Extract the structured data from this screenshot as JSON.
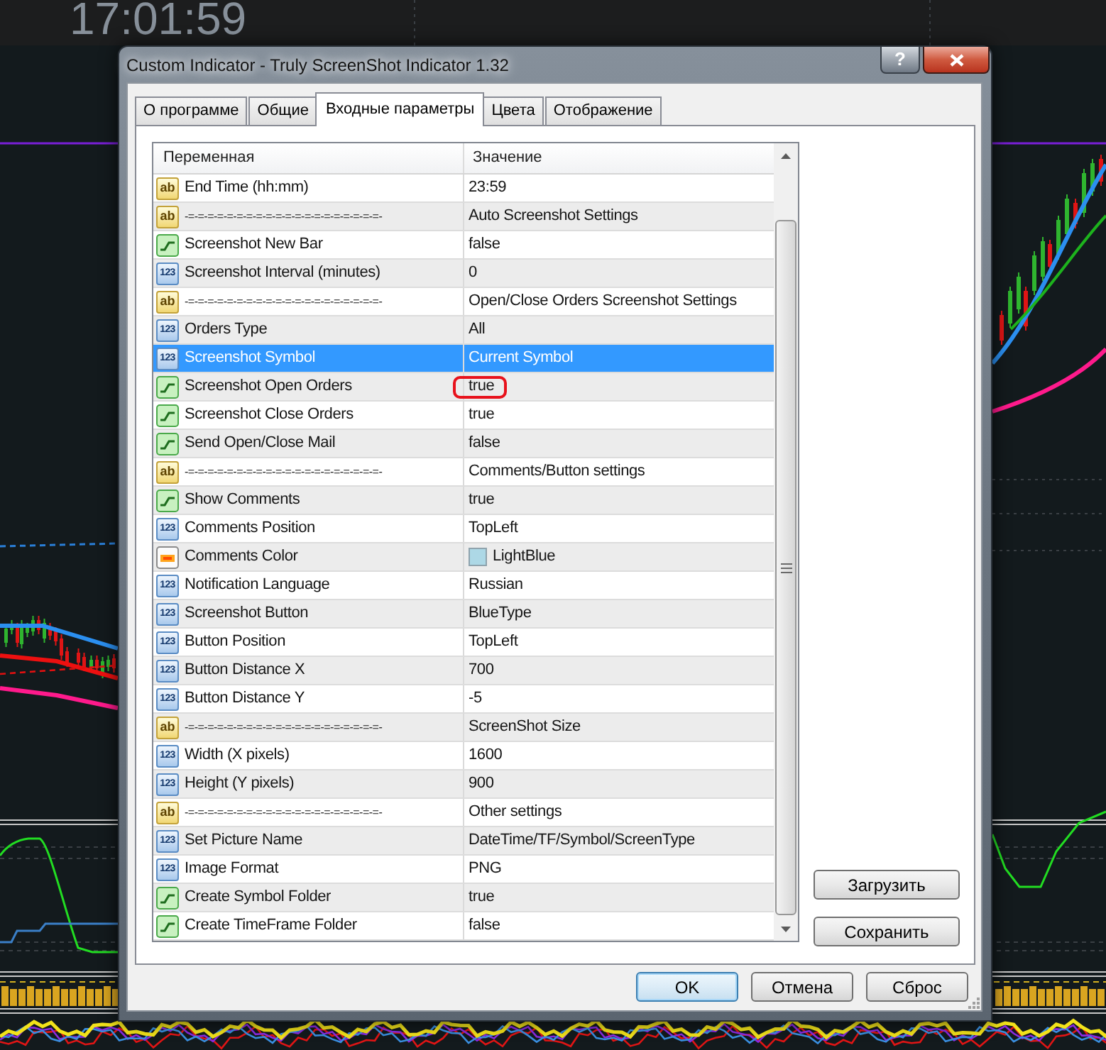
{
  "clock": "17:01:59",
  "window": {
    "title": "Custom Indicator - Truly ScreenShot Indicator 1.32",
    "help_button": "?"
  },
  "tabs": [
    {
      "label": "О программе",
      "selected": false
    },
    {
      "label": "Общие",
      "selected": false
    },
    {
      "label": "Входные параметры",
      "selected": true
    },
    {
      "label": "Цвета",
      "selected": false
    },
    {
      "label": "Отображение",
      "selected": false
    }
  ],
  "table": {
    "columns": [
      "Переменная",
      "Значение"
    ],
    "rows": [
      {
        "kind": "string",
        "type_label": "ab",
        "name": "End Time (hh:mm)",
        "value": "23:59",
        "selected": false,
        "circled": false
      },
      {
        "kind": "separator",
        "type_label": "ab",
        "name": "-=-=-=-=-=-=-=-=-=-=-=-=-=-=-=-=-=-=-=-=-",
        "value": "Auto Screenshot Settings",
        "selected": false,
        "circled": false
      },
      {
        "kind": "bool",
        "name": "Screenshot New Bar",
        "value": "false",
        "selected": false,
        "circled": false
      },
      {
        "kind": "number",
        "type_label": "123",
        "name": "Screenshot Interval (minutes)",
        "value": "0",
        "selected": false,
        "circled": false
      },
      {
        "kind": "separator",
        "type_label": "ab",
        "name": "-=-=-=-=-=-=-=-=-=-=-=-=-=-=-=-=-=-=-=-=-",
        "value": "Open/Close Orders Screenshot Settings",
        "selected": false,
        "circled": false
      },
      {
        "kind": "number",
        "type_label": "123",
        "name": "Orders Type",
        "value": "All",
        "selected": false,
        "circled": false
      },
      {
        "kind": "number",
        "type_label": "123",
        "name": "Screenshot Symbol",
        "value": "Current Symbol",
        "selected": true,
        "circled": false
      },
      {
        "kind": "bool",
        "name": "Screenshot Open Orders",
        "value": "true",
        "selected": false,
        "circled": true
      },
      {
        "kind": "bool",
        "name": "Screenshot Close Orders",
        "value": "true",
        "selected": false,
        "circled": false
      },
      {
        "kind": "bool",
        "name": "Send Open/Close Mail",
        "value": "false",
        "selected": false,
        "circled": false
      },
      {
        "kind": "separator",
        "type_label": "ab",
        "name": "-=-=-=-=-=-=-=-=-=-=-=-=-=-=-=-=-=-=-=-=-",
        "value": "Comments/Button settings",
        "selected": false,
        "circled": false
      },
      {
        "kind": "bool",
        "name": "Show Comments",
        "value": "true",
        "selected": false,
        "circled": false
      },
      {
        "kind": "number",
        "type_label": "123",
        "name": "Comments Position",
        "value": "TopLeft",
        "selected": false,
        "circled": false
      },
      {
        "kind": "color",
        "name": "Comments Color",
        "value": "LightBlue",
        "color": "#add8e6",
        "selected": false,
        "circled": false
      },
      {
        "kind": "number",
        "type_label": "123",
        "name": "Notification Language",
        "value": "Russian",
        "selected": false,
        "circled": false
      },
      {
        "kind": "number",
        "type_label": "123",
        "name": "Screenshot Button",
        "value": "BlueType",
        "selected": false,
        "circled": false
      },
      {
        "kind": "number",
        "type_label": "123",
        "name": "Button Position",
        "value": "TopLeft",
        "selected": false,
        "circled": false
      },
      {
        "kind": "number",
        "type_label": "123",
        "name": "Button Distance X",
        "value": "700",
        "selected": false,
        "circled": false
      },
      {
        "kind": "number",
        "type_label": "123",
        "name": "Button Distance Y",
        "value": "-5",
        "selected": false,
        "circled": false
      },
      {
        "kind": "separator",
        "type_label": "ab",
        "name": "-=-=-=-=-=-=-=-=-=-=-=-=-=-=-=-=-=-=-=-=-",
        "value": "ScreenShot Size",
        "selected": false,
        "circled": false
      },
      {
        "kind": "number",
        "type_label": "123",
        "name": "Width (X pixels)",
        "value": "1600",
        "selected": false,
        "circled": false
      },
      {
        "kind": "number",
        "type_label": "123",
        "name": "Height (Y pixels)",
        "value": "900",
        "selected": false,
        "circled": false
      },
      {
        "kind": "separator",
        "type_label": "ab",
        "name": "-=-=-=-=-=-=-=-=-=-=-=-=-=-=-=-=-=-=-=-=-",
        "value": "Other settings",
        "selected": false,
        "circled": false
      },
      {
        "kind": "number",
        "type_label": "123",
        "name": "Set Picture Name",
        "value": "DateTime/TF/Symbol/ScreenType",
        "selected": false,
        "circled": false
      },
      {
        "kind": "number",
        "type_label": "123",
        "name": "Image Format",
        "value": "PNG",
        "selected": false,
        "circled": false
      },
      {
        "kind": "bool",
        "name": "Create Symbol Folder",
        "value": "true",
        "selected": false,
        "circled": false
      },
      {
        "kind": "bool",
        "name": "Create TimeFrame Folder",
        "value": "false",
        "selected": false,
        "circled": false
      }
    ]
  },
  "side_buttons": [
    "Загрузить",
    "Сохранить"
  ],
  "buttons": [
    {
      "label": "OK",
      "default": true
    },
    {
      "label": "Отмена",
      "default": false
    },
    {
      "label": "Сброс",
      "default": false
    }
  ]
}
